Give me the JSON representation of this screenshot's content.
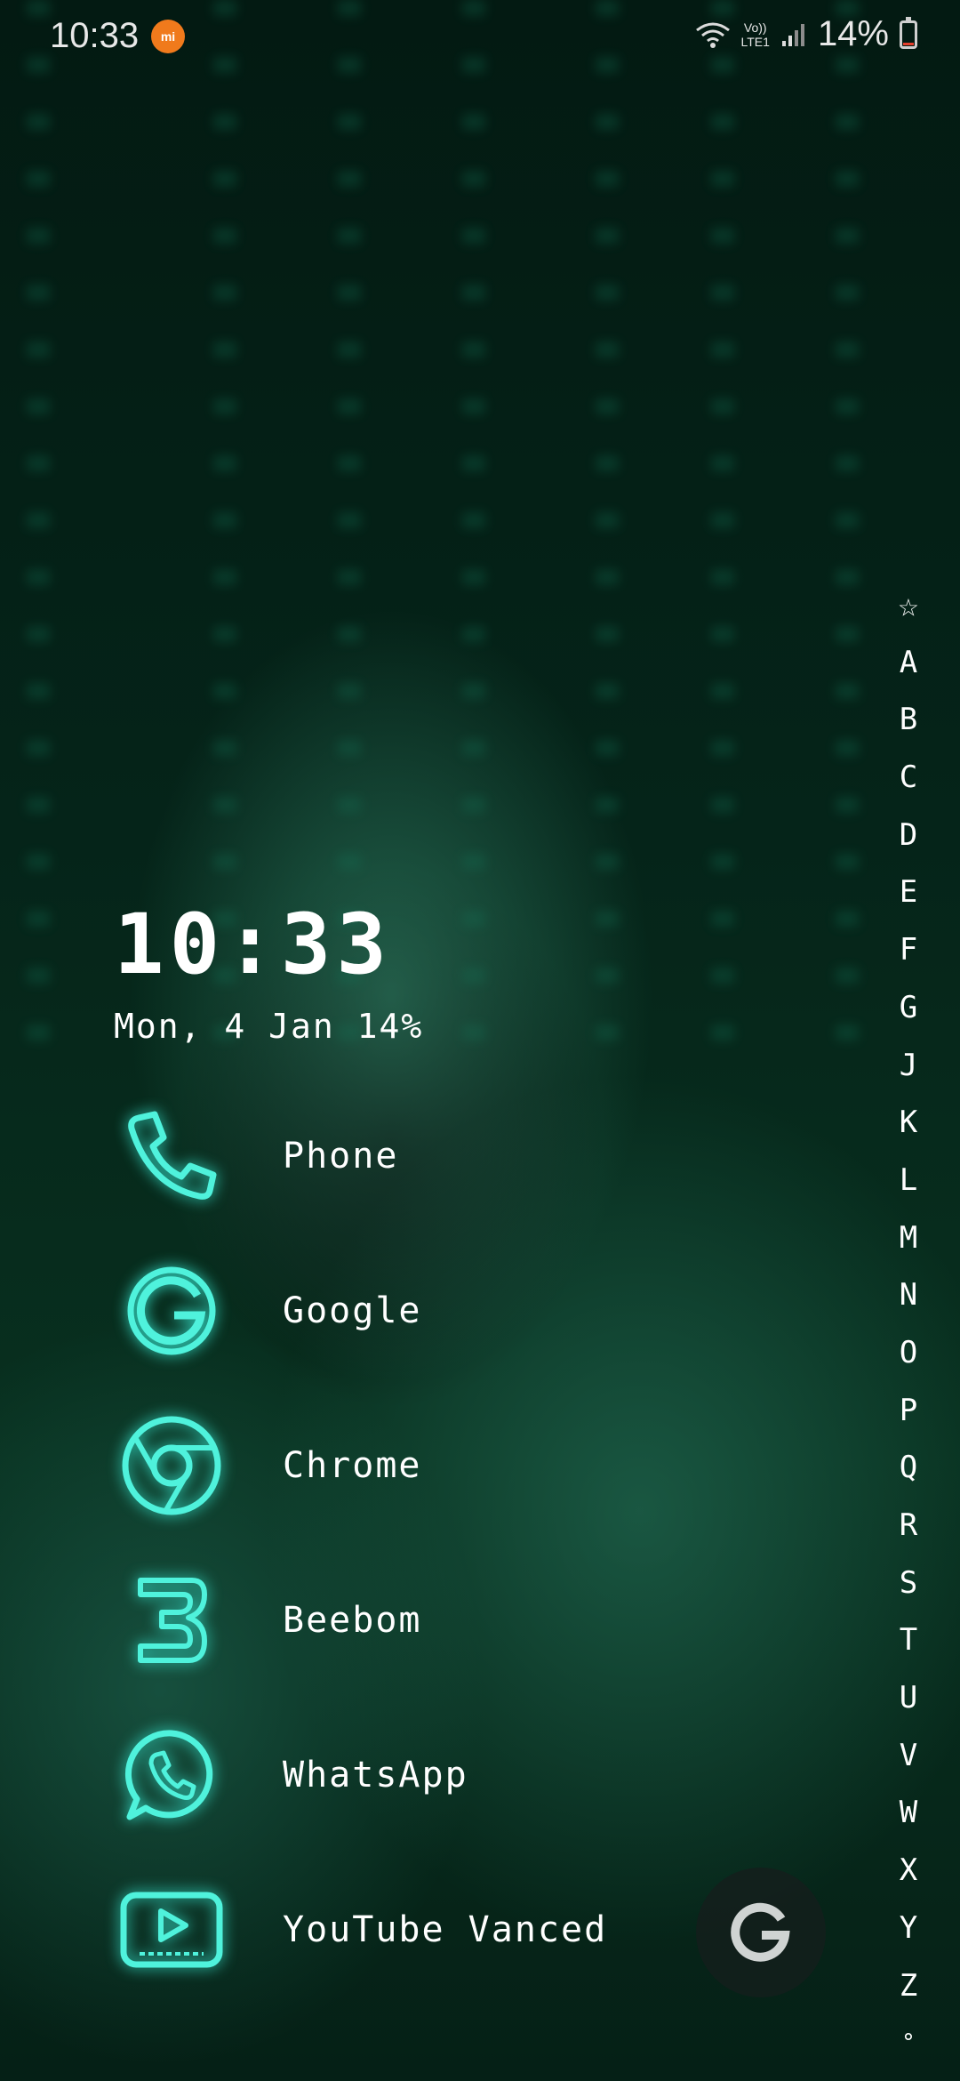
{
  "status_bar": {
    "time": "10:33",
    "notification_icon": "mi-icon",
    "volte_line1": "Vo))",
    "volte_line2": "LTE1",
    "battery_percent": "14%",
    "battery_level": 0.14,
    "battery_color": "#e53e2b"
  },
  "clock_widget": {
    "time": "10:33",
    "date": "Mon, 4 Jan  14%"
  },
  "apps": [
    {
      "label": "Phone",
      "icon": "phone-icon"
    },
    {
      "label": "Google",
      "icon": "google-icon"
    },
    {
      "label": "Chrome",
      "icon": "chrome-icon"
    },
    {
      "label": "Beebom",
      "icon": "beebom-icon"
    },
    {
      "label": "WhatsApp",
      "icon": "whatsapp-icon"
    },
    {
      "label": "YouTube Vanced",
      "icon": "youtube-vanced-icon"
    }
  ],
  "index": {
    "star": "☆",
    "letters": [
      "A",
      "B",
      "C",
      "D",
      "E",
      "F",
      "G",
      "J",
      "K",
      "L",
      "M",
      "N",
      "O",
      "P",
      "Q",
      "R",
      "S",
      "T",
      "U",
      "V",
      "W",
      "X",
      "Y",
      "Z"
    ],
    "end": "°"
  },
  "fab": {
    "icon": "google-g-icon"
  },
  "accent_color": "#36e6d0"
}
